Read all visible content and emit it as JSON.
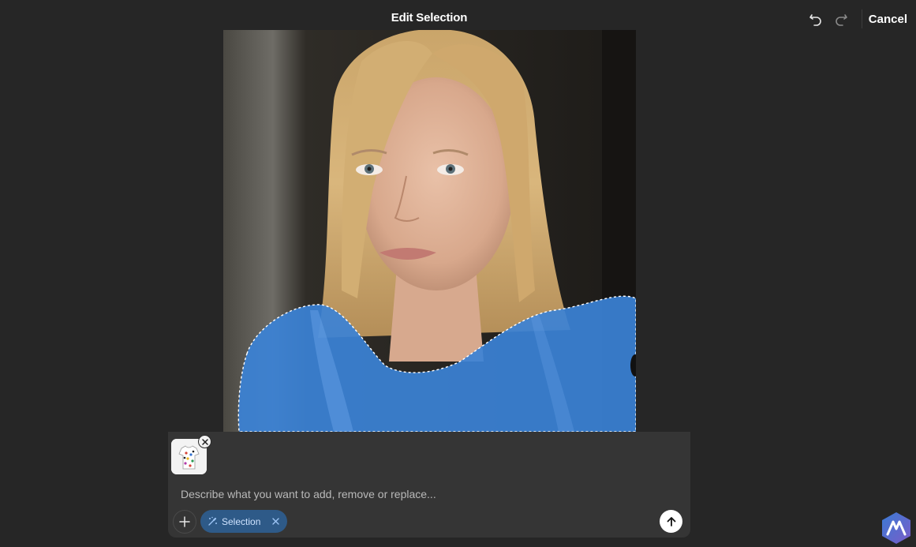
{
  "header": {
    "title": "Edit Selection",
    "undo_icon": "undo-icon",
    "redo_icon": "redo-icon",
    "cancel_label": "Cancel"
  },
  "canvas": {
    "subject": "portrait photo",
    "selection_color": "#3b82d6",
    "selection_border": "dashed white"
  },
  "composer": {
    "attachment_icon": "shirt-thumbnail",
    "placeholder": "Describe what you want to add, remove or replace...",
    "value": "",
    "add_icon": "plus-icon",
    "chip_label": "Selection",
    "chip_icon": "selection-brush-icon",
    "send_icon": "arrow-up-icon"
  },
  "colors": {
    "background": "#262626",
    "composer": "#353535",
    "chip": "#2e5a88",
    "chip_text": "#cfe3ff"
  },
  "brand": {
    "icon": "brand-logo-icon"
  }
}
